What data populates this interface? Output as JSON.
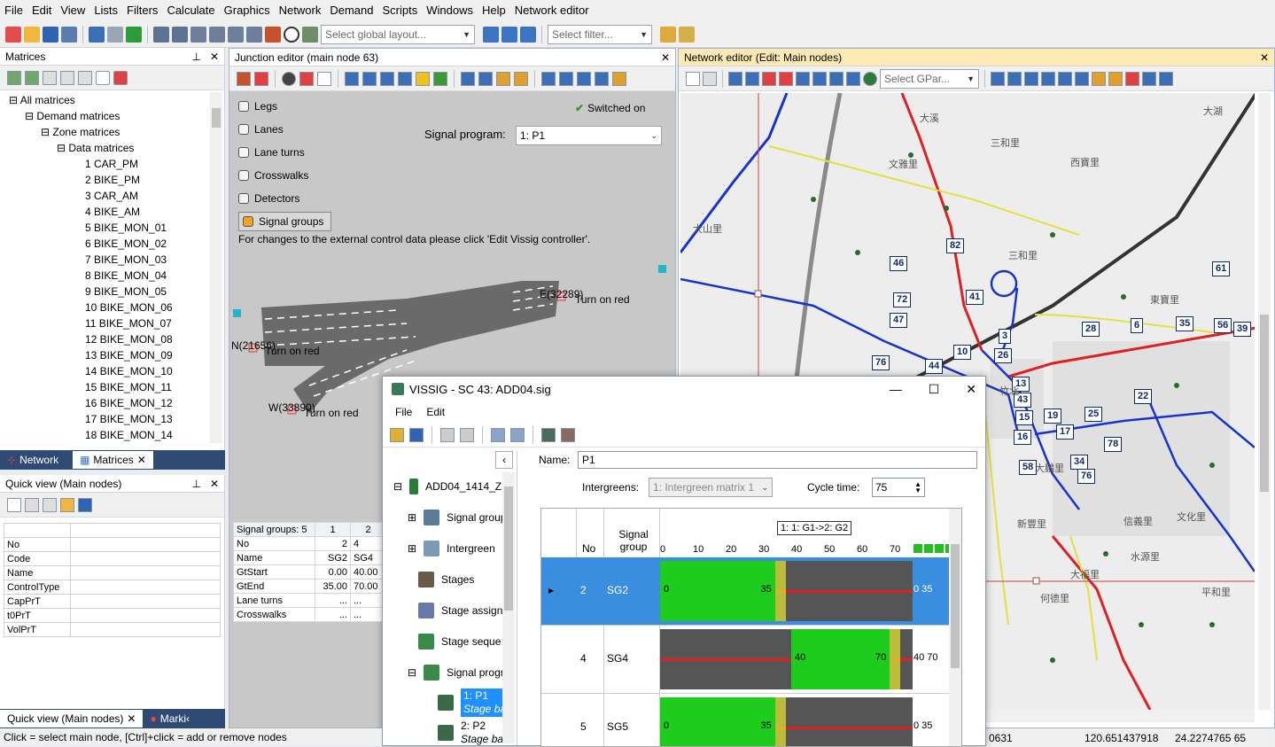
{
  "menu": [
    "File",
    "Edit",
    "View",
    "Lists",
    "Filters",
    "Calculate",
    "Graphics",
    "Network",
    "Demand",
    "Scripts",
    "Windows",
    "Help",
    "Network editor"
  ],
  "toolbar": {
    "layout_placeholder": "Select global layout...",
    "filter_placeholder": "Select filter..."
  },
  "matrices": {
    "title": "Matrices",
    "root": "All matrices",
    "demand": "Demand matrices",
    "zone": "Zone matrices",
    "data": "Data matrices",
    "items": [
      "1 CAR_PM",
      "2 BIKE_PM",
      "3 CAR_AM",
      "4 BIKE_AM",
      "5 BIKE_MON_01",
      "6 BIKE_MON_02",
      "7 BIKE_MON_03",
      "8 BIKE_MON_04",
      "9 BIKE_MON_05",
      "10 BIKE_MON_06",
      "11 BIKE_MON_07",
      "12 BIKE_MON_08",
      "13 BIKE_MON_09",
      "14 BIKE_MON_10",
      "15 BIKE_MON_11",
      "16 BIKE_MON_12",
      "17 BIKE_MON_13",
      "18 BIKE_MON_14"
    ],
    "tab_network": "Network",
    "tab_matrices": "Matrices"
  },
  "quickview": {
    "title": "Quick view (Main nodes)",
    "rows": [
      "No",
      "Code",
      "Name",
      "ControlType",
      "CapPrT",
      "t0PrT",
      "VolPrT"
    ],
    "tab1": "Quick view (Main nodes)",
    "tab2": "Marki‹"
  },
  "junction": {
    "title": "Junction editor (main node 63)",
    "checks": [
      "Legs",
      "Lanes",
      "Lane turns",
      "Crosswalks",
      "Detectors",
      "Signal groups"
    ],
    "switched": "Switched on",
    "signal_program_label": "Signal program:",
    "signal_program_value": "1: P1",
    "note": "For changes to the external control data please click 'Edit Vissig controller'.",
    "labels": {
      "e": "E(32289)",
      "n": "N(21656)",
      "w": "W(33890)",
      "red1": "Turn on red",
      "red2": "Turn on red",
      "red3": "Turn on red"
    },
    "grid": {
      "head": [
        "Signal groups: 5",
        "1",
        "2"
      ],
      "rows": [
        [
          "No",
          "2",
          "4"
        ],
        [
          "Name",
          "SG2",
          "SG4"
        ],
        [
          "GtStart",
          "0.00",
          "40.00"
        ],
        [
          "GtEnd",
          "35.00",
          "70.00"
        ],
        [
          "Lane turns",
          "...",
          "..."
        ],
        [
          "Crosswalks",
          "...",
          "..."
        ]
      ]
    }
  },
  "network": {
    "title": "Network editor (Edit: Main nodes)",
    "gpar_placeholder": "Select GPar...",
    "nodes": [
      "46",
      "82",
      "72",
      "41",
      "61",
      "47",
      "3",
      "28",
      "6",
      "35",
      "56",
      "39",
      "76",
      "44",
      "10",
      "26",
      "22",
      "25",
      "78",
      "34",
      "76",
      "58",
      "16",
      "17",
      "19",
      "15",
      "43",
      "13"
    ],
    "places": [
      "大湖",
      "大溪",
      "西寶里",
      "三和里",
      "文雅里",
      "大山里",
      "東寶里",
      "三和里",
      "大鵬里",
      "新豐里",
      "竹北",
      "大福里",
      "水源里",
      "文化里",
      "信義里",
      "平和里",
      "何德里"
    ],
    "status": [
      "0631",
      "120.651437918",
      "24.2274765 65"
    ]
  },
  "vissig": {
    "title": "VISSIG - SC 43: ADD04.sig",
    "menu": [
      "File",
      "Edit"
    ],
    "tree": [
      "ADD04_1414_Z",
      "Signal group",
      "Intergreen",
      "Stages",
      "Stage assign",
      "Stage seque",
      "Signal progr",
      "1: P1",
      "Stage ba",
      "2: P2",
      "Stage ba"
    ],
    "name_label": "Name:",
    "name_value": "P1",
    "intergreens_label": "Intergreens:",
    "intergreens_value": "1: Intergreen matrix 1",
    "cycle_label": "Cycle time:",
    "cycle_value": "75",
    "col_no": "No",
    "col_sg": "Signal group",
    "axis": [
      "0",
      "10",
      "20",
      "30",
      "40",
      "50",
      "60",
      "70"
    ],
    "tooltip": "1: 1: G1->2: G2",
    "rows": [
      {
        "no": "2",
        "sg": "SG2",
        "start": "0",
        "end": "35",
        "right": "0 35"
      },
      {
        "no": "4",
        "sg": "SG4",
        "start": "40",
        "end": "70",
        "right": "40 70"
      },
      {
        "no": "5",
        "sg": "SG5",
        "start": "0",
        "end": "35",
        "right": "0 35"
      }
    ]
  },
  "statusbar": "Click = select main node, [Ctrl]+click = add or remove nodes"
}
